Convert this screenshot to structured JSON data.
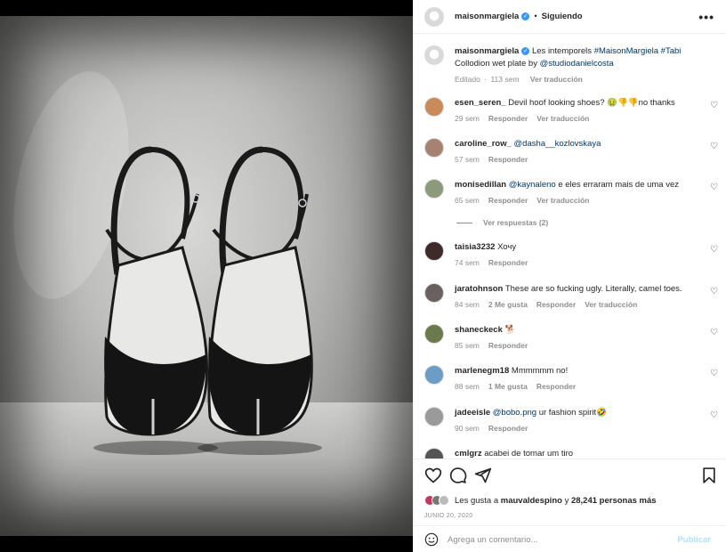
{
  "header": {
    "username": "maisonmargiela",
    "separator": "•",
    "follow_label": "Siguiendo",
    "more": "•••"
  },
  "caption": {
    "username": "maisonmargiela",
    "text_plain": "Les intemporels ",
    "tag1": "#MaisonMargiela",
    "tag2": "#Tabi",
    "line2_plain": "Collodion wet plate by ",
    "mention": "@studiodanielcosta",
    "edited": "Editado",
    "dot": "·",
    "age": "113 sem",
    "translate": "Ver traducción"
  },
  "comments": [
    {
      "user": "esen_seren_",
      "text": "Devil hoof looking shoes? 🤢👎👎no thanks",
      "age": "29 sem",
      "reply": "Responder",
      "translate": "Ver traducción",
      "avatar_color": "#c98a5a"
    },
    {
      "user": "caroline_row_",
      "mention": "@dasha__kozlovskaya",
      "age": "57 sem",
      "reply": "Responder",
      "avatar_color": "#a78172"
    },
    {
      "user": "monisedillan",
      "mention": "@kaynaleno",
      "text": "e eles erraram mais de uma vez",
      "age": "65 sem",
      "reply": "Responder",
      "translate": "Ver traducción",
      "avatar_color": "#8b9a7a"
    },
    {
      "user": "taisia3232",
      "text": "Хочу",
      "age": "74 sem",
      "reply": "Responder",
      "avatar_color": "#3e2a2a"
    },
    {
      "user": "jaratohnson",
      "text": "These are so fucking ugly. Literally, camel toes.",
      "age": "84 sem",
      "likes": "2 Me gusta",
      "reply": "Responder",
      "translate": "Ver traducción",
      "avatar_color": "#6a6060"
    },
    {
      "user": "shaneckeck",
      "text": "🐕",
      "age": "85 sem",
      "reply": "Responder",
      "avatar_color": "#6b7a4b"
    },
    {
      "user": "marlenegm18",
      "text": "Mmmmmm no!",
      "age": "88 sem",
      "likes": "1 Me gusta",
      "reply": "Responder",
      "avatar_color": "#6d9cc6"
    },
    {
      "user": "jadeeisle",
      "mention": "@bobo.png",
      "text": "ur fashion spirit🤣",
      "age": "90 sem",
      "reply": "Responder",
      "avatar_color": "#9a9a9a"
    },
    {
      "user": "cmlgrz",
      "text": "acabei de tomar um tiro",
      "avatar_color": "#555555"
    }
  ],
  "view_replies": "Ver respuestas (2)",
  "likes": {
    "prefix": "Les gusta a ",
    "user": "mauvaldespino",
    "connector": " y ",
    "count": "28,241 personas más"
  },
  "date": "JUNIO 20, 2020",
  "add_comment": {
    "placeholder": "Agrega un comentario...",
    "post_label": "Publicar"
  }
}
